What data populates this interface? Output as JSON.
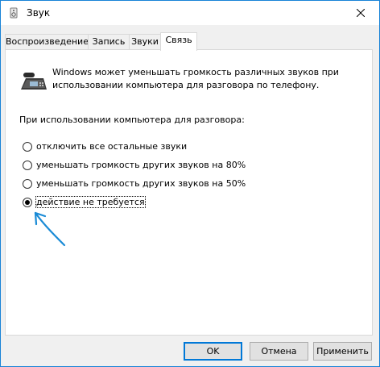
{
  "window": {
    "title": "Звук",
    "title_icon": "speaker-icon",
    "close_glyph": "✕"
  },
  "tabs": [
    {
      "label": "Воспроизведение",
      "active": false
    },
    {
      "label": "Запись",
      "active": false
    },
    {
      "label": "Звуки",
      "active": false
    },
    {
      "label": "Связь",
      "active": true
    }
  ],
  "communications": {
    "intro": "Windows может уменьшать громкость различных звуков при использовании компьютера для разговора по телефону.",
    "question": "При использовании компьютера для разговора:",
    "options": [
      {
        "label": "отключить все остальные звуки",
        "checked": false
      },
      {
        "label": "уменьшать громкость других звуков на 80%",
        "checked": false
      },
      {
        "label": "уменьшать громкость других звуков на 50%",
        "checked": false
      },
      {
        "label": "действие не требуется",
        "checked": true
      }
    ]
  },
  "buttons": {
    "ok": "OK",
    "cancel": "Отмена",
    "apply": "Применить"
  },
  "colors": {
    "accent": "#0078d7",
    "annotation_arrow": "#1a8bd6"
  }
}
